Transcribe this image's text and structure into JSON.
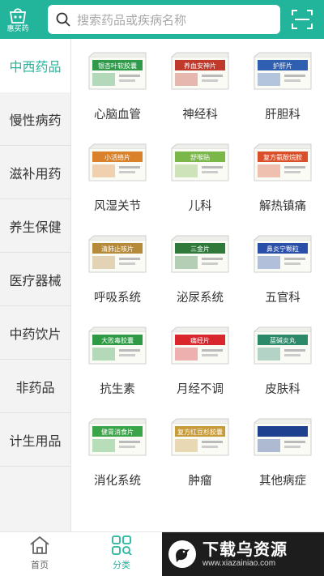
{
  "header": {
    "logo_text": "惠买药",
    "search_placeholder": "搜索药品或疾病名称"
  },
  "sidebar": {
    "items": [
      {
        "label": "中西药品",
        "active": true
      },
      {
        "label": "慢性病药",
        "active": false
      },
      {
        "label": "滋补用药",
        "active": false
      },
      {
        "label": "养生保健",
        "active": false
      },
      {
        "label": "医疗器械",
        "active": false
      },
      {
        "label": "中药饮片",
        "active": false
      },
      {
        "label": "非药品",
        "active": false
      },
      {
        "label": "计生用品",
        "active": false
      }
    ]
  },
  "categories": [
    {
      "label": "心脑血管",
      "box_text": "银杏叶软胶囊",
      "color": "#2e9a4a"
    },
    {
      "label": "神经科",
      "box_text": "养血安神片",
      "color": "#c0392b"
    },
    {
      "label": "肝胆科",
      "box_text": "护肝片",
      "color": "#2f5fb0"
    },
    {
      "label": "风湿关节",
      "box_text": "小活络片",
      "color": "#d9822b"
    },
    {
      "label": "儿科",
      "box_text": "舒喉贴",
      "color": "#7ab648"
    },
    {
      "label": "解热镇痛",
      "box_text": "复方氨酚烷胺",
      "color": "#d94f2a"
    },
    {
      "label": "呼吸系统",
      "box_text": "清肺止咳片",
      "color": "#b58a3b"
    },
    {
      "label": "泌尿系统",
      "box_text": "三金片",
      "color": "#2f7a3a"
    },
    {
      "label": "五官科",
      "box_text": "鼻炎宁颗粒",
      "color": "#2a4fa8"
    },
    {
      "label": "抗生素",
      "box_text": "大败毒胶囊",
      "color": "#2f9a45"
    },
    {
      "label": "月经不调",
      "box_text": "痛经片",
      "color": "#d8262c"
    },
    {
      "label": "皮肤科",
      "box_text": "蓝碱炎丸",
      "color": "#2c8a6a"
    },
    {
      "label": "消化系统",
      "box_text": "健胃消食片",
      "color": "#3aa548"
    },
    {
      "label": "肿瘤",
      "box_text": "复方红豆杉胶囊",
      "color": "#c79a3a"
    },
    {
      "label": "其他病症",
      "box_text": "",
      "color": "#1f3f8f"
    }
  ],
  "tabbar": {
    "home_label": "首页",
    "category_label": "分类"
  },
  "watermark": {
    "title": "下载乌资源",
    "url": "www.xiazainiao.com"
  },
  "colors": {
    "accent": "#23b59c",
    "sidebar_bg": "#f3f3f3"
  }
}
